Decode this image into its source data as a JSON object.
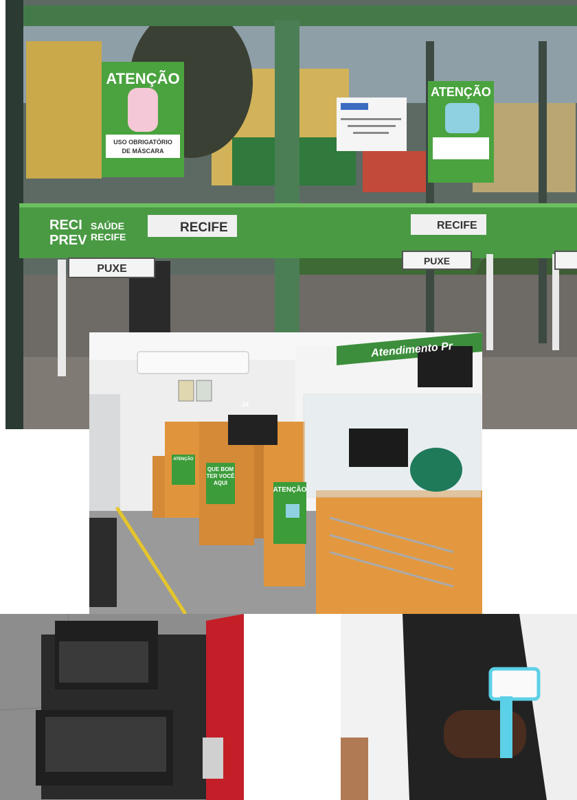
{
  "photos": {
    "storefront": {
      "door_signs": [
        {
          "heading": "ATENÇÃO",
          "caption_1": "USO OBRIGATÓRIO",
          "caption_2": "DE MÁSCARA"
        },
        {
          "heading": "ATENÇÃO"
        }
      ],
      "brand": {
        "reci": "RECI",
        "prev": "PREV",
        "saude": "SAÚDE",
        "recife_small": "RECIFE",
        "recife": "RECIFE"
      },
      "push_label": "PUXE"
    },
    "office": {
      "wall_banner": "Atendimento Pr",
      "desk_number": "34",
      "posters": [
        {
          "text_1": "ATENÇÃO"
        },
        {
          "text_1": "QUE BOM",
          "text_2": "TER VOCÊ",
          "text_3": "AQUI"
        },
        {
          "text_1": "ATENÇÃO"
        }
      ]
    }
  },
  "colors": {
    "brand_green": "#3f8f3a",
    "sign_green": "#4aa33f",
    "wood": "#d98f3a",
    "tile": "#8d8d8d"
  }
}
